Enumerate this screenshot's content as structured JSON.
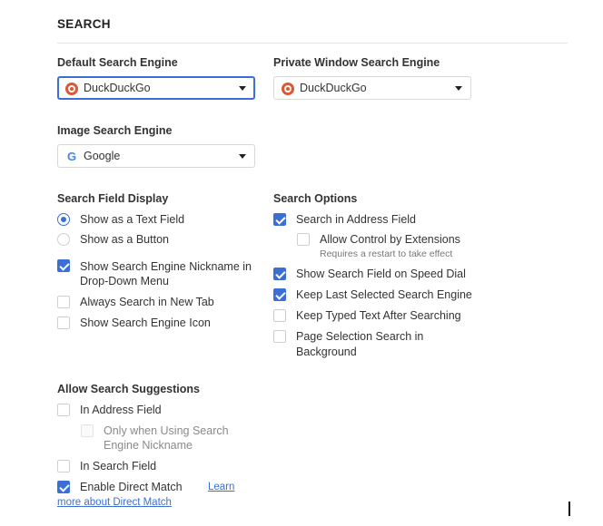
{
  "section": {
    "title": "SEARCH"
  },
  "default_engine": {
    "label": "Default Search Engine",
    "value": "DuckDuckGo",
    "icon": "duckduckgo-icon"
  },
  "private_engine": {
    "label": "Private Window Search Engine",
    "value": "DuckDuckGo",
    "icon": "duckduckgo-icon"
  },
  "image_engine": {
    "label": "Image Search Engine",
    "value": "Google",
    "icon": "google-icon",
    "icon_glyph": "G"
  },
  "field_display": {
    "label": "Search Field Display",
    "options": [
      {
        "label": "Show as a Text Field",
        "checked": true
      },
      {
        "label": "Show as a Button",
        "checked": false
      }
    ],
    "checkboxes": [
      {
        "label_line1": "Show Search Engine Nickname in",
        "label_line2": "Drop-Down Menu",
        "checked": true
      },
      {
        "label": "Always Search in New Tab",
        "checked": false
      },
      {
        "label": "Show Search Engine Icon",
        "checked": false
      }
    ]
  },
  "search_options": {
    "label": "Search Options",
    "items": [
      {
        "label": "Search in Address Field",
        "checked": true
      },
      {
        "label": "Allow Control by Extensions",
        "note": "Requires a restart to take effect",
        "checked": false
      },
      {
        "label": "Show Search Field on Speed Dial",
        "checked": true
      },
      {
        "label": "Keep Last Selected Search Engine",
        "checked": true
      },
      {
        "label": "Keep Typed Text After Searching",
        "checked": false
      },
      {
        "label_line1": "Page Selection Search in",
        "label_line2": "Background",
        "checked": false
      }
    ]
  },
  "suggestions": {
    "label": "Allow Search Suggestions",
    "items": [
      {
        "label": "In Address Field",
        "checked": false
      },
      {
        "label_line1": "Only when Using Search",
        "label_line2": "Engine Nickname",
        "checked": false,
        "disabled": true
      },
      {
        "label": "In Search Field",
        "checked": false
      },
      {
        "label": "Enable Direct Match",
        "checked": true
      }
    ],
    "learn_more_part1": "Learn",
    "learn_more_part2": "more about Direct Match"
  },
  "colors": {
    "accent": "#3b6fd4",
    "ddg": "#de5833",
    "google_blue": "#4285f4"
  }
}
